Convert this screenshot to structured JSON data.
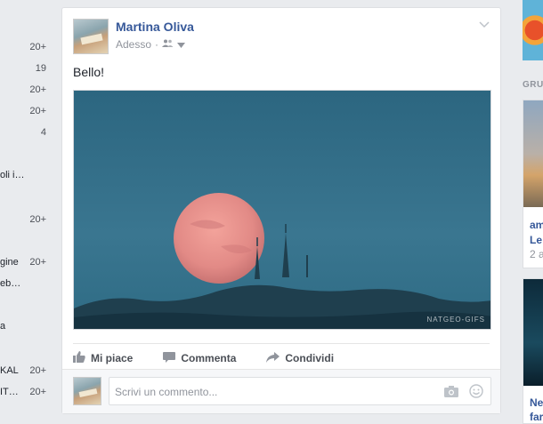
{
  "left_sidebar": {
    "items": [
      {
        "label": "",
        "count": "20+"
      },
      {
        "label": "",
        "count": "19"
      },
      {
        "label": "",
        "count": "20+"
      },
      {
        "label": "",
        "count": "20+"
      },
      {
        "label": "",
        "count": "4"
      },
      {
        "label": "oli i…",
        "count": ""
      },
      {
        "label": "",
        "count": "20+"
      },
      {
        "label": "gine",
        "count": "20+"
      },
      {
        "label": "eb…",
        "count": ""
      },
      {
        "label": "a",
        "count": ""
      },
      {
        "label": "KAL",
        "count": "20+"
      },
      {
        "label": "IT…",
        "count": "20+"
      }
    ]
  },
  "post": {
    "author": "Martina Oliva",
    "time": "Adesso",
    "audience_icon": "friends-icon",
    "text": "Bello!",
    "image_caption": "NATGEO-GIFS",
    "actions": {
      "like": "Mi piace",
      "comment": "Commenta",
      "share": "Condividi"
    },
    "comment_placeholder": "Scrivi un commento..."
  },
  "right_column": {
    "heading": "GRU",
    "cards": [
      {
        "title": "am",
        "subtitle": "Le",
        "meta": "2 a"
      },
      {
        "title": "Ne",
        "subtitle": "far",
        "meta": ""
      }
    ]
  },
  "colors": {
    "link": "#365899",
    "background": "#e9ebee",
    "muted": "#90949c"
  }
}
